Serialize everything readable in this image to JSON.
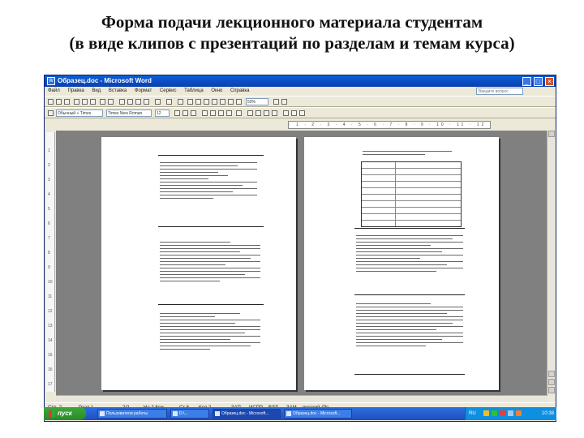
{
  "slide": {
    "title_line1": "Форма подачи лекционного материала студентам",
    "title_line2": "(в виде клипов с презентаций по разделам и темам курса)"
  },
  "window": {
    "title": "Образец.doc - Microsoft Word",
    "buttons": {
      "minimize": "_",
      "maximize": "□",
      "close": "×"
    },
    "menu": [
      "Файл",
      "Правка",
      "Вид",
      "Вставка",
      "Формат",
      "Сервис",
      "Таблица",
      "Окно",
      "Справка"
    ],
    "help_placeholder": "Введите вопрос",
    "zoom": "50%",
    "style": "Обычный + Times",
    "font": "Times New Roman",
    "size": "12",
    "ruler": "· 1 · 2 · 3 · 4 · 5 · 6 · 7 · 8 · 9 · 10 · 11 · 12 ·",
    "vruler": [
      "1",
      "2",
      "3",
      "4",
      "5",
      "6",
      "7",
      "8",
      "9",
      "10",
      "11",
      "12",
      "13",
      "14",
      "15",
      "16",
      "17"
    ],
    "status": {
      "page": "Стр. 2",
      "section": "Разд 1",
      "pages": "2/2",
      "at": "На 2,6см",
      "line": "Ст 6",
      "col": "Кол 2",
      "rec": "ЗАП",
      "trk": "ИСПР",
      "ext": "ВДЛ",
      "ovr": "ЗАМ",
      "lang": "русский (Ро"
    }
  },
  "taskbar": {
    "start": "пуск",
    "tasks": [
      "Пользователи работы",
      "D:\\...",
      "Образец.doc - Microsoft...",
      "Образец.doc - Microsoft..."
    ],
    "lang": "RU",
    "clock": "10:38"
  }
}
